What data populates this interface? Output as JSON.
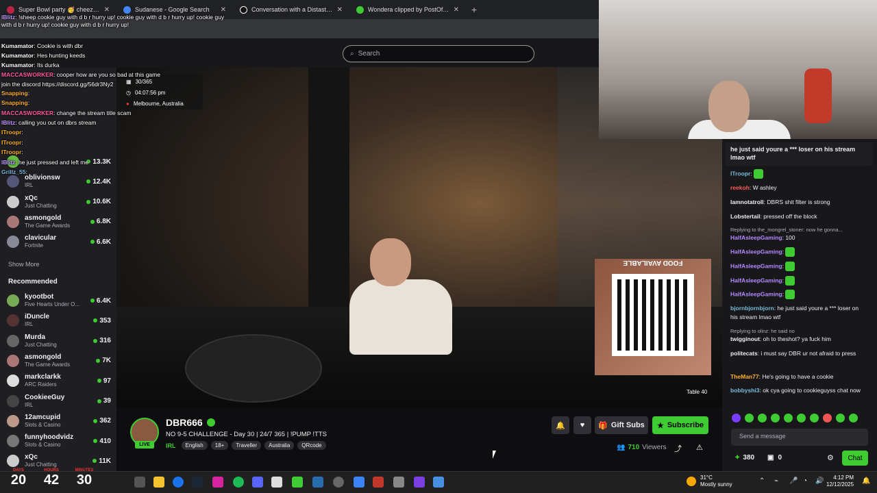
{
  "browser": {
    "tabs": [
      {
        "title": "Super Bowl party 🥳 cheez muddy bang",
        "active": false
      },
      {
        "title": "Sudanese - Google Search",
        "active": false
      },
      {
        "title": "Conversation with a Distasteful",
        "active": false
      },
      {
        "title": "Wondera clipped by PostOffice",
        "active": false
      }
    ],
    "newtab": "+"
  },
  "search": {
    "placeholder": "Search"
  },
  "overlay_chat": [
    {
      "user": "lBlitz",
      "text": "!sheep cookie guy with d b r hurry up! cookie guy with d b r hurry up! cookie guy with d b r hurry up! cookie guy with d b r hurry up!",
      "color": "#c29aff"
    },
    {
      "user": "Kumamator",
      "text": "Cookie is with dbr",
      "color": "#fff"
    },
    {
      "user": "Kumamator",
      "text": "Hes hunting keeds",
      "color": "#fff"
    },
    {
      "user": "Kumamator",
      "text": "Its durka",
      "color": "#fff"
    },
    {
      "user": "MACCASWORKER",
      "text": "cooper how are you so bad at this game",
      "color": "#ff5aa0"
    },
    {
      "user": "",
      "text": "join the discord https://discord.gg/56dr3Ny2",
      "color": "#fff"
    },
    {
      "user": "Snapping",
      "text": "",
      "color": "#ffb02e"
    },
    {
      "user": "Snapping",
      "text": "",
      "color": "#ffb02e"
    },
    {
      "user": "MACCASWORKER",
      "text": "change the stream title scam",
      "color": "#ff5aa0"
    },
    {
      "user": "lBlitz",
      "text": "calling you out on dbrs stream",
      "color": "#c29aff"
    },
    {
      "user": "ITroopr",
      "text": "",
      "color": "#ffb02e"
    },
    {
      "user": "ITroopr",
      "text": "",
      "color": "#ffb02e"
    },
    {
      "user": "ITroopr",
      "text": "",
      "color": "#ffb02e"
    },
    {
      "user": "lBlitz",
      "text": "he just pressed and left me",
      "color": "#c29aff"
    },
    {
      "user": "Grillz_55",
      "text": "",
      "color": "#7bd"
    }
  ],
  "stream_overlay": {
    "day": "30/365",
    "time": "04:07:56 pm",
    "location": "Melbourne, Australia"
  },
  "sidebar": {
    "following": [
      {
        "name": "",
        "game": "",
        "viewers": "13.3K",
        "color": "#6b4"
      },
      {
        "name": "oblivionsw",
        "game": "IRL",
        "viewers": "12.4K",
        "color": "#557"
      },
      {
        "name": "xQc",
        "game": "Just Chatting",
        "viewers": "10.6K",
        "color": "#ccc"
      },
      {
        "name": "asmongold",
        "game": "The Game Awards",
        "viewers": "6.8K",
        "color": "#a77"
      },
      {
        "name": "clavicular",
        "game": "Fortnite",
        "viewers": "6.6K",
        "color": "#889"
      }
    ],
    "show_more": "Show More",
    "recommended_title": "Recommended",
    "recommended": [
      {
        "name": "kyootbot",
        "game": "Five Hearts Under O...",
        "viewers": "6.4K",
        "color": "#7a5"
      },
      {
        "name": "iDuncle",
        "game": "IRL",
        "viewers": "353",
        "color": "#533"
      },
      {
        "name": "Murda",
        "game": "Just Chatting",
        "viewers": "316",
        "color": "#666"
      },
      {
        "name": "asmongold",
        "game": "The Game Awards",
        "viewers": "7K",
        "color": "#a77"
      },
      {
        "name": "markclarkk",
        "game": "ARC Raiders",
        "viewers": "97",
        "color": "#ddd"
      },
      {
        "name": "CookieeGuy",
        "game": "IRL",
        "viewers": "39",
        "color": "#444"
      },
      {
        "name": "12amcupid",
        "game": "Slots & Casino",
        "viewers": "362",
        "color": "#b98"
      },
      {
        "name": "funnyhoodvidz",
        "game": "Slots & Casino",
        "viewers": "410",
        "color": "#777"
      },
      {
        "name": "xQc",
        "game": "Just Chatting",
        "viewers": "11K",
        "color": "#ccc"
      }
    ]
  },
  "video": {
    "qr_label": "FOOD AVAILABLE",
    "table_label": "Table 40"
  },
  "stream": {
    "name": "DBR666",
    "title": "NO 9-5 CHALLENGE - Day 30 | 24/7 365 | !PUMP !TTS",
    "category": "IRL",
    "tags": [
      "English",
      "18+",
      "Traveller",
      "Australia",
      "QRcode"
    ],
    "live": "LIVE",
    "viewers": "710",
    "viewers_label": "Viewers",
    "gift_label": "Gift Subs",
    "subscribe_label": "Subscribe"
  },
  "chat": {
    "pinned": "he just said youre a *** loser on his stream lmao wtf",
    "messages": [
      {
        "user": "ITroopr",
        "text": "",
        "color": "#7bd",
        "reply": false
      },
      {
        "user": "reekoh",
        "text": "W ashley",
        "color": "#ff5a5a",
        "reply": false
      },
      {
        "user": "Iamnotatroll",
        "text": "DBRS shit filter is strong",
        "color": "#efeff1",
        "reply": false
      },
      {
        "user": "Lobstertail",
        "text": "pressed off the block",
        "color": "#efeff1",
        "reply": false
      },
      {
        "user": "",
        "text": "Replying to the_mongrel_stoner: now he gonna...",
        "color": "#adadb8",
        "reply": true
      },
      {
        "user": "HalfAsleepGaming",
        "text": "100",
        "color": "#b38aff",
        "reply": false
      },
      {
        "user": "HalfAsleepGaming",
        "text": "",
        "color": "#b38aff",
        "reply": false
      },
      {
        "user": "HalfAsleepGaming",
        "text": "",
        "color": "#b38aff",
        "reply": false
      },
      {
        "user": "HalfAsleepGaming",
        "text": "",
        "color": "#b38aff",
        "reply": false
      },
      {
        "user": "HalfAsleepGaming",
        "text": "",
        "color": "#b38aff",
        "reply": false
      },
      {
        "user": "bjornbjornbjorn",
        "text": "he just said youre a *** loser on his stream lmao wtf",
        "color": "#7bd",
        "reply": false
      },
      {
        "user": "",
        "text": "Replying to olinz: he said no",
        "color": "#adadb8",
        "reply": true
      },
      {
        "user": "twigginout",
        "text": "oh to theshot? ya fuck him",
        "color": "#efeff1",
        "reply": false
      },
      {
        "user": "politecats",
        "text": "i must say DBR ur not afraid to press",
        "color": "#efeff1",
        "reply": false
      },
      {
        "user": "TheMan77",
        "text": "He's going to have a cookie",
        "color": "#ffb02e",
        "reply": false
      },
      {
        "user": "bobbyshi3",
        "text": "ok cya going to cookieguyss chat now",
        "color": "#7bd",
        "reply": false
      }
    ],
    "input_placeholder": "Send a message",
    "points": "380",
    "chest": "0",
    "chat_button": "Chat"
  },
  "taskbar": {
    "countdown": [
      {
        "label": "DAYS",
        "value": "20"
      },
      {
        "label": "HOURS",
        "value": "42"
      },
      {
        "label": "MINUTES",
        "value": "30"
      }
    ],
    "weather_temp": "31°C",
    "weather_desc": "Mostly sunny",
    "time": "4:12 PM",
    "date": "12/12/2025"
  },
  "colors": {
    "accent": "#3ecc32",
    "live": "#eb0400",
    "bg": "#0e0e10"
  }
}
